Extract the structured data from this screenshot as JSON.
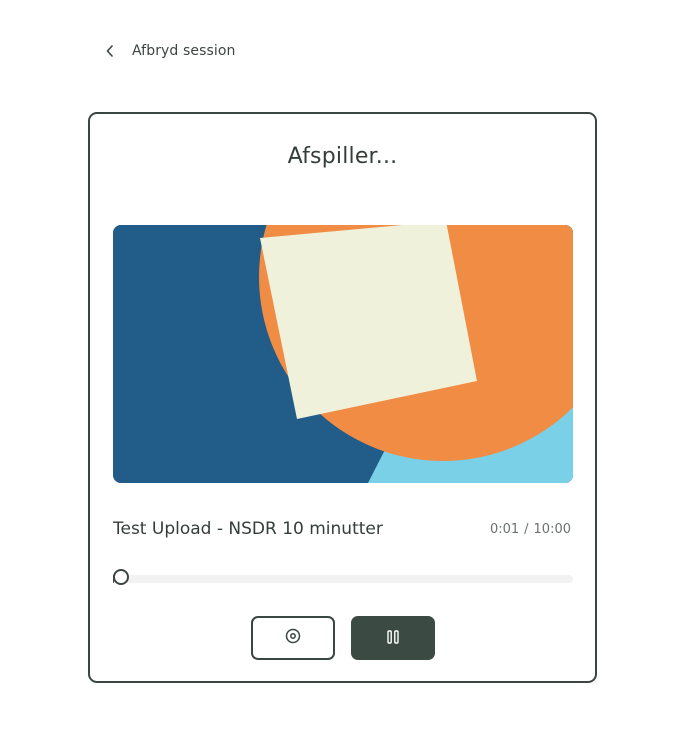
{
  "nav": {
    "back_label": "Afbryd session",
    "back_icon": "chevron-left-icon"
  },
  "player": {
    "status": "Afspiller...",
    "track_title": "Test Upload - NSDR 10 minutter",
    "elapsed": "0:01",
    "separator": "/",
    "duration": "10:00",
    "progress_fraction": 0.0017,
    "artwork_colors": {
      "background": "#225c88",
      "accent_light_blue": "#7ad0e6",
      "circle": "#f08c44",
      "square": "#f0f1db"
    },
    "buttons": {
      "secondary_icon": "target-circle-icon",
      "primary_icon": "pause-icon"
    }
  },
  "theme": {
    "dark": "#3b4640",
    "text": "#343e39",
    "muted": "#6b726e",
    "track": "#f2f2f2"
  }
}
